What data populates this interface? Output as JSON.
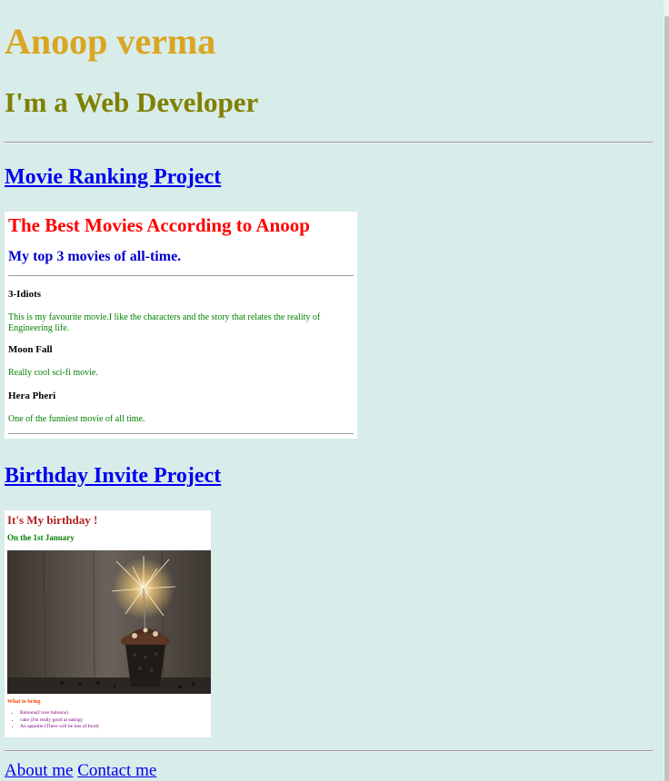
{
  "header": {
    "name": "Anoop verma",
    "tagline": "I'm a Web Developer"
  },
  "projects": [
    {
      "link_text": "Movie Ranking Project",
      "preview": {
        "title": "The Best Movies According to Anoop",
        "subtitle": "My top 3 movies of all-time.",
        "movies": [
          {
            "name": "3-Idiots",
            "description": "This is my favourite movie.I like the characters and the story that relates the reality of Engineering life."
          },
          {
            "name": "Moon Fall",
            "description": "Really cool sci-fi movie."
          },
          {
            "name": "Hera Pheri",
            "description": "One of the funniest movie of all time."
          }
        ]
      }
    },
    {
      "link_text": "Birthday Invite Project",
      "preview": {
        "title": "It's My birthday !",
        "date": "On the 1st January",
        "image_alt": "cupcake with sparkler",
        "bring_heading": "What to bring",
        "items": [
          "Baloons(I love baloons)",
          "cake (I'm really good at eating)",
          "An appetite (There will be lots of food)"
        ]
      }
    }
  ],
  "footer": {
    "about_label": "About me",
    "contact_label": "Contact me"
  },
  "colors": {
    "background": "#d8ecea",
    "name": "#daa520",
    "tagline": "#808000",
    "link": "#0000ee"
  }
}
